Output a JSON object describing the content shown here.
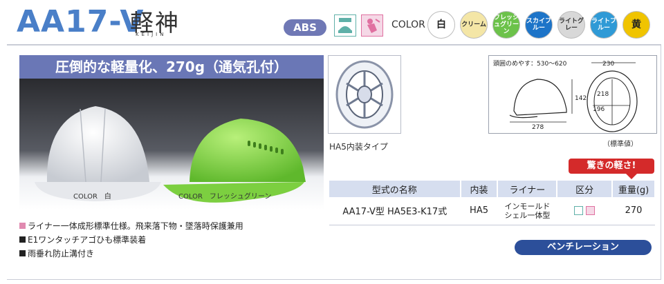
{
  "header": {
    "model": "AA17-V",
    "series_kanji": "軽神",
    "series_roman": "KEIJIN",
    "material_badge": "ABS",
    "color_label": "COLOR",
    "colors": [
      {
        "label": "白",
        "bg": "#ffffff",
        "fg": "#222222"
      },
      {
        "label": "クリーム",
        "bg": "#f4e6a6",
        "fg": "#333333"
      },
      {
        "label": "フレッシュグリーン",
        "bg": "#6cc24a",
        "fg": "#ffffff"
      },
      {
        "label": "スカイブルー",
        "bg": "#1d74c8",
        "fg": "#ffffff"
      },
      {
        "label": "ライトグレー",
        "bg": "#d8d8d8",
        "fg": "#333333"
      },
      {
        "label": "ライトブルー",
        "bg": "#2f9ad6",
        "fg": "#ffffff"
      },
      {
        "label": "黄",
        "bg": "#f0c400",
        "fg": "#222222"
      }
    ]
  },
  "hero": {
    "banner": "圧倒的な軽量化、270g（通気孔付）",
    "caption_left": "COLOR　白",
    "caption_right": "COLOR　フレッシュグリーン"
  },
  "liner": {
    "caption": "HA5内装タイプ"
  },
  "dimensions": {
    "head_range": "頭囲のめやす：530～620",
    "d142": "142",
    "d278": "278",
    "d230": "230",
    "d218": "218",
    "d196": "196",
    "note": "（標準値）"
  },
  "light_badge": "驚きの軽さ!",
  "spec_table": {
    "headers": [
      "型式の名称",
      "内装",
      "ライナー",
      "区分",
      "重量(g)"
    ],
    "row": {
      "name": "AA17-V型 HA5E3-K17式",
      "interior": "HA5",
      "liner": "インモールド\nシェル一体型",
      "weight": "270"
    }
  },
  "features": [
    {
      "text": "ライナー一体成形標準仕様。飛来落下物・墜落時保護兼用",
      "bullet_color": "pink"
    },
    {
      "text": "E1ワンタッチアゴひも標準装着",
      "bullet_color": "black"
    },
    {
      "text": "雨垂れ防止溝付き",
      "bullet_color": "black"
    }
  ],
  "ventilation_label": "ベンチレーション"
}
